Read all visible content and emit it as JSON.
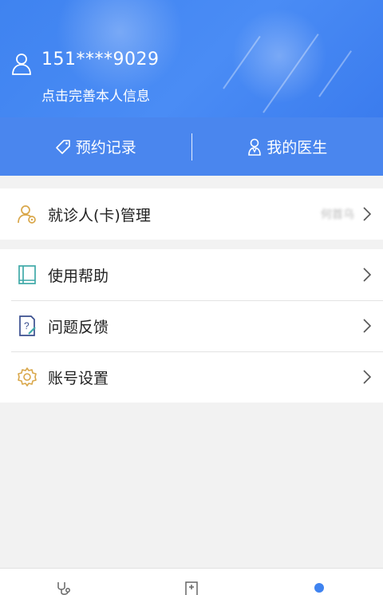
{
  "header": {
    "phone": "151****9029",
    "subtitle": "点击完善本人信息"
  },
  "tabs": [
    {
      "label": "预约记录",
      "icon": "tag-icon"
    },
    {
      "label": "我的医生",
      "icon": "doctor-icon"
    }
  ],
  "patient_row": {
    "label": "就诊人(卡)管理",
    "value": "何首乌",
    "icon": "patient-card-icon"
  },
  "menu": [
    {
      "label": "使用帮助",
      "icon": "book-icon"
    },
    {
      "label": "问题反馈",
      "icon": "feedback-icon"
    },
    {
      "label": "账号设置",
      "icon": "gear-icon"
    }
  ],
  "bottom_nav": [
    {
      "icon": "stethoscope-icon",
      "active": false
    },
    {
      "icon": "clinic-icon",
      "active": false
    },
    {
      "icon": "profile-icon",
      "active": true
    }
  ],
  "colors": {
    "primary_blue": "#4a86ee",
    "header_blue": "#3f83f0",
    "icon_orange": "#d9a74a",
    "icon_teal": "#3fa9a8",
    "icon_navy": "#3a4f8f"
  }
}
